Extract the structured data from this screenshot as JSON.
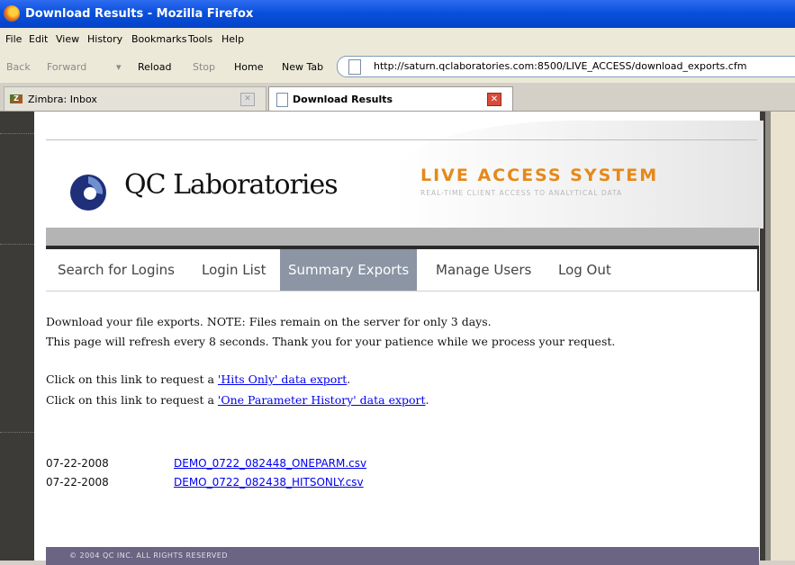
{
  "window": {
    "title": "Download Results - Mozilla Firefox"
  },
  "menu": [
    "File",
    "Edit",
    "View",
    "History",
    "Bookmarks",
    "Tools",
    "Help"
  ],
  "nav": {
    "back": "Back",
    "forward": "Forward",
    "dropdown": "▾",
    "reload": "Reload",
    "stop": "Stop",
    "home": "Home",
    "newtab": "New Tab",
    "url": "http://saturn.qclaboratories.com:8500/LIVE_ACCESS/download_exports.cfm"
  },
  "tabs": [
    {
      "label": "Zimbra: Inbox",
      "close": "✕"
    },
    {
      "label": "Download Results",
      "close": "✕"
    }
  ],
  "site": {
    "logo_text": "QC Laboratories",
    "system_title": "LIVE ACCESS SYSTEM",
    "system_subtitle": "REAL-TIME CLIENT ACCESS TO ANALYTICAL DATA",
    "nav": [
      "Search for Logins",
      "Login List",
      "Summary Exports",
      "Manage Users",
      "Log Out"
    ],
    "active_nav": "Summary Exports",
    "footer": "© 2004 QC INC.  ALL RIGHTS RESERVED"
  },
  "content": {
    "note_line1": "Download your file exports. NOTE: Files remain on the server for only 3 days.",
    "note_line2": "This page will refresh every 8 seconds. Thank you for your patience while we process your request.",
    "req1_prefix": "Click on this link to request a ",
    "req1_link": "'Hits Only' data export",
    "req1_suffix": ".",
    "req2_prefix": "Click on this link to request a ",
    "req2_link": "'One Parameter History' data export",
    "req2_suffix": ".",
    "files": [
      {
        "date": "07-22-2008",
        "name": "DEMO_0722_082448_ONEPARM.csv"
      },
      {
        "date": "07-22-2008",
        "name": "DEMO_0722_082438_HITSONLY.csv"
      }
    ]
  },
  "colors": {
    "accent_orange": "#e5891a",
    "active_tab": "#8b95a3",
    "footer": "#6b6482",
    "link": "#0000ee"
  }
}
